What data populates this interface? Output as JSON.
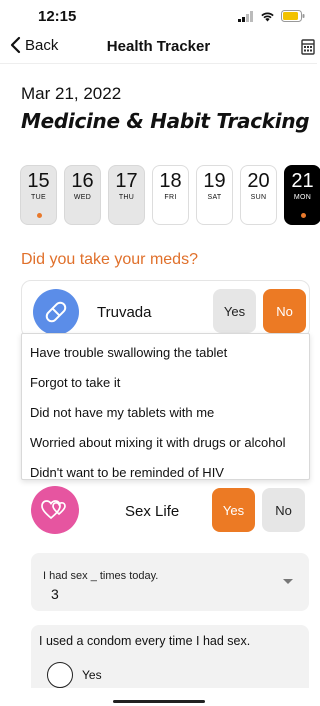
{
  "status_bar": {
    "time": "12:15"
  },
  "nav": {
    "back_label": "Back",
    "title": "Health Tracker"
  },
  "date": "Mar 21, 2022",
  "page_title": "Medicine & Habit Tracking",
  "days": [
    {
      "num": "15",
      "name": "TUE",
      "state": "past",
      "dot": true
    },
    {
      "num": "16",
      "name": "WED",
      "state": "past",
      "dot": false
    },
    {
      "num": "17",
      "name": "THU",
      "state": "past",
      "dot": false
    },
    {
      "num": "18",
      "name": "FRI",
      "state": "future",
      "dot": false
    },
    {
      "num": "19",
      "name": "SAT",
      "state": "future",
      "dot": false
    },
    {
      "num": "20",
      "name": "SUN",
      "state": "future",
      "dot": false
    },
    {
      "num": "21",
      "name": "MON",
      "state": "selected",
      "dot": true
    }
  ],
  "meds_question": "Did you take your meds?",
  "medication": {
    "name": "Truvada",
    "yes_label": "Yes",
    "no_label": "No",
    "selected": "No"
  },
  "reasons": [
    "Have trouble swallowing the tablet",
    "Forgot to take it",
    "Did not have my tablets with me",
    "Worried about mixing it with drugs or alcohol",
    "Didn't want to be reminded of HIV"
  ],
  "sex_life": {
    "label": "Sex Life",
    "yes_label": "Yes",
    "no_label": "No",
    "selected": "Yes"
  },
  "times": {
    "label": "I had sex _ times today.",
    "value": "3"
  },
  "condom": {
    "question": "I used a condom every time I had sex.",
    "option_yes": "Yes"
  },
  "colors": {
    "accent_orange": "#ec7a24",
    "pill_blue": "#5b8de8",
    "heart_pink": "#e655a0",
    "selected_day": "#000000"
  },
  "icons": {
    "pill": "pill-icon",
    "heart": "hearts-icon",
    "calendar": "calendar-icon"
  }
}
